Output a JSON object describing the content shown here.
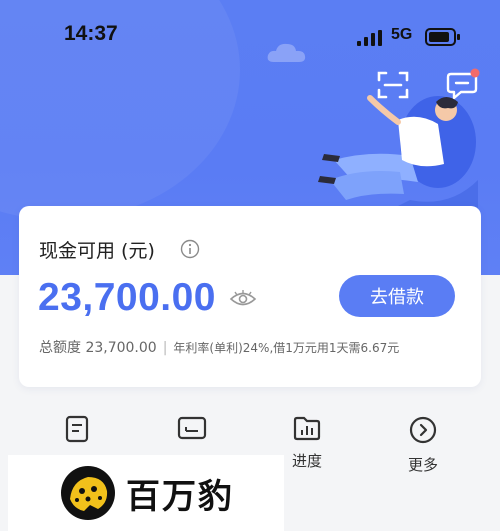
{
  "status_bar": {
    "time": "14:37",
    "network": "5G"
  },
  "header": {
    "scan_icon": "scan-icon",
    "message_icon": "message-icon"
  },
  "card": {
    "title": "现金可用 (元)",
    "amount": "23,700.00",
    "borrow_button": "去借款",
    "quota_label": "总额度 23,700.00",
    "rate_text": "年利率(单利)24%,借1万元用1天需6.67元"
  },
  "menu": {
    "items": [
      {
        "label": "",
        "icon": "document-icon"
      },
      {
        "label": "",
        "icon": "repay-icon"
      },
      {
        "label": "进度",
        "icon": "progress-icon"
      },
      {
        "label": "更多",
        "icon": "more-icon"
      }
    ]
  },
  "brand": {
    "name": "百万豹"
  },
  "colors": {
    "primary": "#5a7df4",
    "amount": "#4a6ff0",
    "badge": "#f26b6b"
  }
}
